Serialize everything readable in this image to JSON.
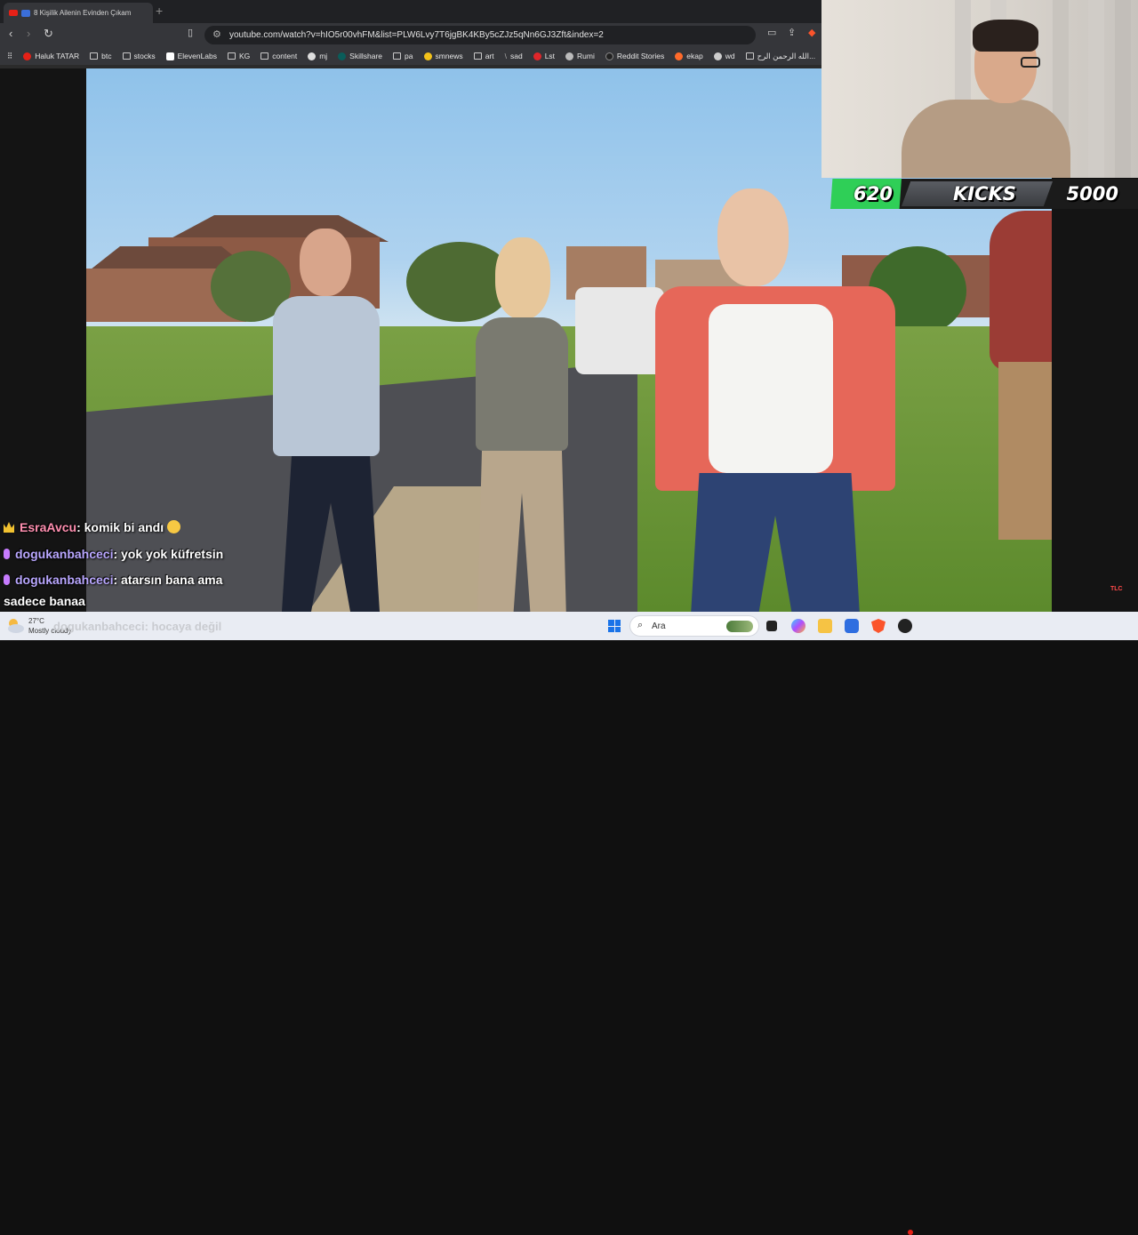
{
  "browser": {
    "tab_title": "8 Kişilik Ailenin Evinden Çıkam",
    "new_tab": "+",
    "url": "youtube.com/watch?v=hIO5r00vhFM&list=PLW6Lvy7T6jgBK4KBy5cZJz5qNn6GJ3Zft&index=2",
    "bookmarks": [
      "Haluk TATAR",
      "btc",
      "stocks",
      "ElevenLabs",
      "KG",
      "content",
      "mj",
      "Skillshare",
      "pa",
      "smnews",
      "art",
      "sad",
      "Lst",
      "Rumi",
      "Reddit Stories",
      "ekap",
      "wd",
      "الله الرحمن الرح..."
    ]
  },
  "kicks": {
    "current": "620",
    "label": "KICKS",
    "goal": "5000",
    "progress_fraction": 0.124,
    "fill_color": "#2fcf57"
  },
  "chat": [
    {
      "badge": "crown",
      "user": "EsraAvcu",
      "text": ": komik bi andı",
      "emoji": "grinning-face"
    },
    {
      "badge": "mic",
      "user": "dogukanbahceci",
      "text": ": yok yok küfretsin"
    },
    {
      "badge": "mic",
      "user": "dogukanbahceci",
      "text": ": atarsın bana ama"
    },
    {
      "badge": "",
      "user": "",
      "text": "sadece banaa"
    },
    {
      "badge": "",
      "user": "dogukanbahceci",
      "text": ": hocaya değil"
    }
  ],
  "video": {
    "watermark": "TLC"
  },
  "taskbar": {
    "temperature": "27°C",
    "weather": "Mostly cloudy",
    "search_placeholder": "Ara"
  }
}
